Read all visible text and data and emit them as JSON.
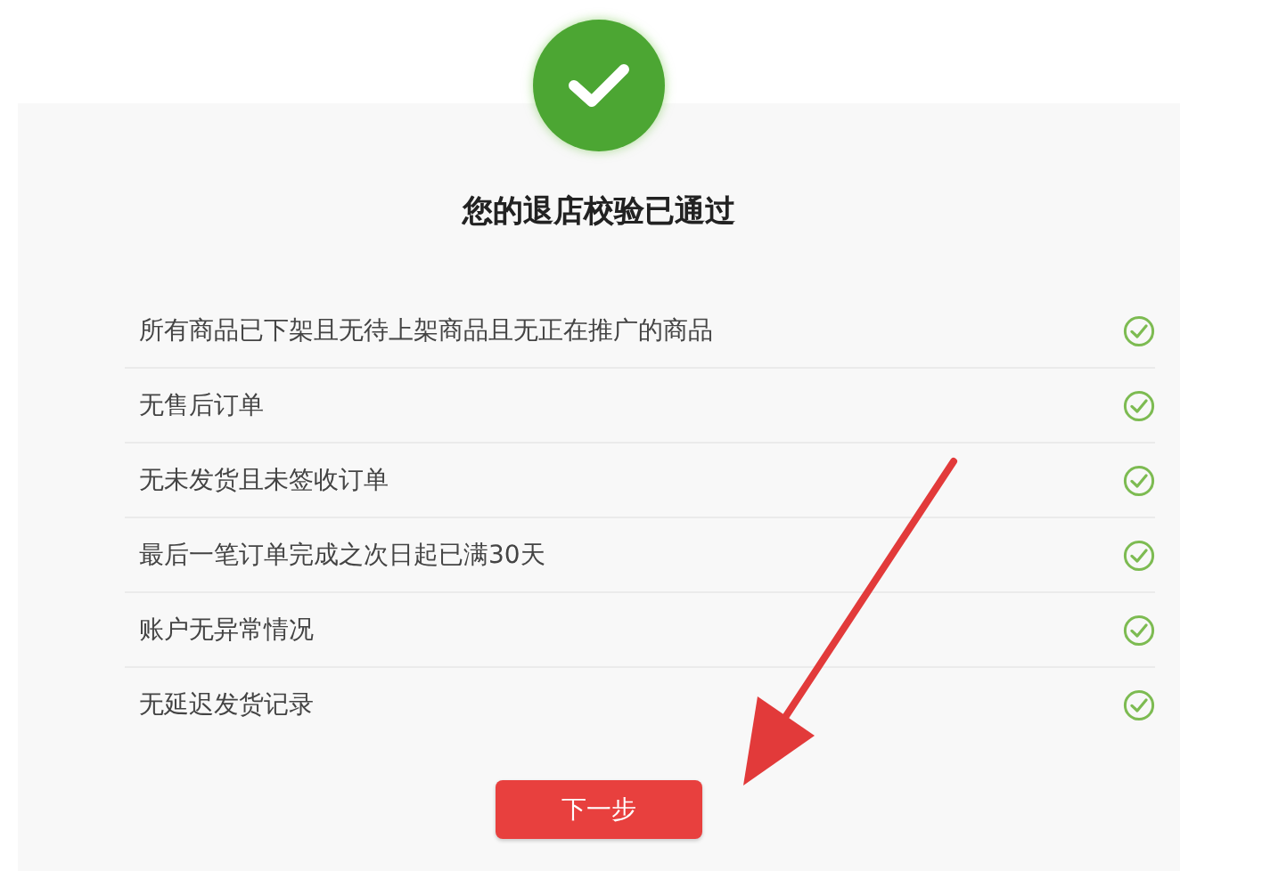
{
  "status": {
    "passed": true
  },
  "title": "您的退店校验已通过",
  "checks": [
    {
      "label": "所有商品已下架且无待上架商品且无正在推广的商品",
      "passed": true
    },
    {
      "label": "无售后订单",
      "passed": true
    },
    {
      "label": "无未发货且未签收订单",
      "passed": true
    },
    {
      "label": "最后一笔订单完成之次日起已满30天",
      "passed": true
    },
    {
      "label": "账户无异常情况",
      "passed": true
    },
    {
      "label": "无延迟发货记录",
      "passed": true
    }
  ],
  "button": "下一步"
}
